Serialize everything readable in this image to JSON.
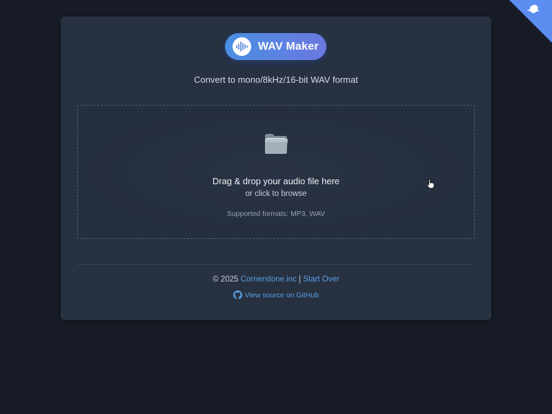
{
  "header": {
    "app_title": "WAV Maker",
    "logo_icon": "waveform-icon",
    "subtitle": "Convert to mono/8kHz/16-bit WAV format"
  },
  "dropzone": {
    "icon": "folder-icon",
    "title": "Drag & drop your audio file here",
    "subtitle": "or click to browse",
    "formats": "Supported formats: MP3, WAV"
  },
  "footer": {
    "copyright": "© 2025",
    "company_link": "Cornerstone.inc",
    "separator": "|",
    "start_over_link": "Start Over",
    "github_icon": "github-icon",
    "github_link": "View source on GitHub"
  },
  "corner": {
    "icon": "bird-icon",
    "color": "#5b8ef0"
  },
  "colors": {
    "background": "#181c27",
    "card": "#273140",
    "accent": "#4a8fe2",
    "link": "#5aa0e8"
  }
}
